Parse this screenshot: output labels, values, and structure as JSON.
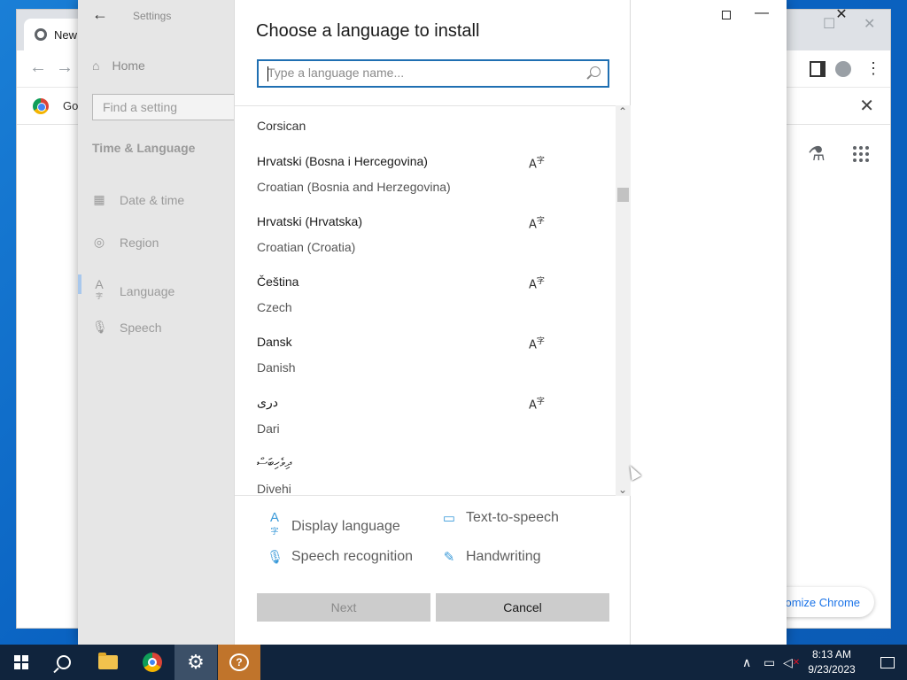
{
  "browser": {
    "tab_label": "New",
    "bookmark_label": "Go",
    "customize_label": "tomize Chrome"
  },
  "settings": {
    "window_title": "Settings",
    "home_label": "Home",
    "search_placeholder": "Find a setting",
    "section_label": "Time & Language",
    "nav": [
      {
        "label": "Date & time",
        "icon": "calendar-icon"
      },
      {
        "label": "Region",
        "icon": "globe-icon"
      },
      {
        "label": "Language",
        "icon": "language-icon"
      },
      {
        "label": "Speech",
        "icon": "microphone-icon"
      }
    ],
    "active_nav": "Language"
  },
  "dialog": {
    "heading": "Choose a language to install",
    "search_placeholder": "Type a language name...",
    "languages": [
      {
        "native": "Corsican",
        "english": ""
      },
      {
        "native": "Hrvatski (Bosna i Hercegovina)",
        "english": "Croatian (Bosnia and Herzegovina)",
        "display_language": true
      },
      {
        "native": "Hrvatski (Hrvatska)",
        "english": "Croatian (Croatia)",
        "display_language": true
      },
      {
        "native": "Čeština",
        "english": "Czech",
        "display_language": true
      },
      {
        "native": "Dansk",
        "english": "Danish",
        "display_language": true
      },
      {
        "native": "دری",
        "english": "Dari",
        "display_language": true
      },
      {
        "native": "ދިވެހިބަސް",
        "english": "Divehi",
        "display_language": false
      }
    ],
    "features": {
      "display_language": "Display language",
      "text_to_speech": "Text-to-speech",
      "speech_recognition": "Speech recognition",
      "handwriting": "Handwriting"
    },
    "buttons": {
      "next": "Next",
      "cancel": "Cancel"
    }
  },
  "taskbar": {
    "time": "8:13 AM",
    "date": "9/23/2023"
  },
  "colors": {
    "accent": "#1f6fb2",
    "feature_icon": "#3a9ad9",
    "taskbar": "#10243d"
  }
}
